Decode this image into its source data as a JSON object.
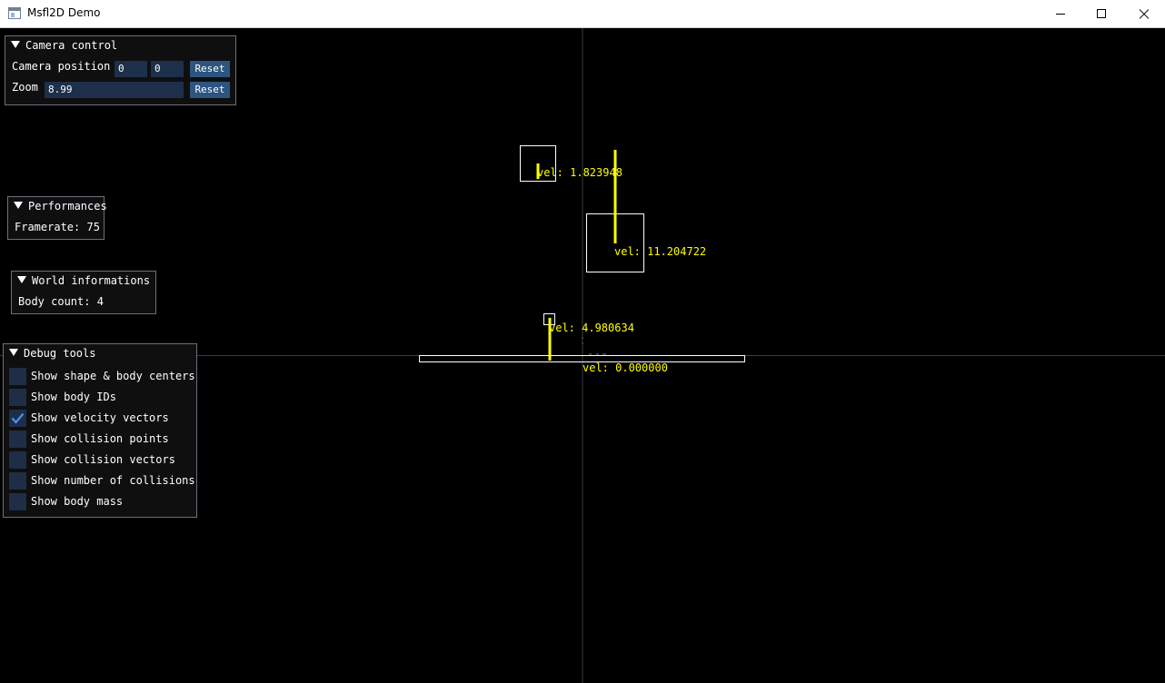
{
  "window": {
    "title": "Msfl2D Demo"
  },
  "camera_panel": {
    "title": "Camera control",
    "position_label": "Camera position",
    "pos_x": "0",
    "pos_y": "0",
    "reset_position": "Reset",
    "zoom_label": "Zoom",
    "zoom_value": "8.99",
    "reset_zoom": "Reset"
  },
  "perf_panel": {
    "title": "Performances",
    "framerate": "Framerate: 75"
  },
  "world_panel": {
    "title": "World informations",
    "body_count": "Body count: 4"
  },
  "debug_panel": {
    "title": "Debug tools",
    "options": [
      {
        "label": "Show shape & body centers",
        "checked": false
      },
      {
        "label": "Show body IDs",
        "checked": false
      },
      {
        "label": "Show velocity vectors",
        "checked": true
      },
      {
        "label": "Show collision points",
        "checked": false
      },
      {
        "label": "Show collision vectors",
        "checked": false
      },
      {
        "label": "Show number of collisions",
        "checked": false
      },
      {
        "label": "Show body mass",
        "checked": false
      }
    ]
  },
  "bodies": [
    {
      "velocity_label": "vel: 1.823948"
    },
    {
      "velocity_label": "vel: 11.204722"
    },
    {
      "velocity_label": "vel: 4.980634"
    },
    {
      "velocity_label": "vel: 0.000000"
    }
  ],
  "colors": {
    "background": "#000000",
    "body_outline": "#ffffff",
    "velocity": "#ffff00",
    "axes": "#3c3c3c",
    "panel_bg": "#0f0f0f",
    "panel_border": "#6e6e7f",
    "field_bg": "#1d2f4a",
    "button_bg": "#2e5480",
    "checkbox_bg": "#1f2d47",
    "checkmark": "#4296fa"
  },
  "icons": [
    "app-icon",
    "minimize-icon",
    "maximize-icon",
    "close-icon",
    "collapse-arrow-icon",
    "checkmark-icon"
  ]
}
